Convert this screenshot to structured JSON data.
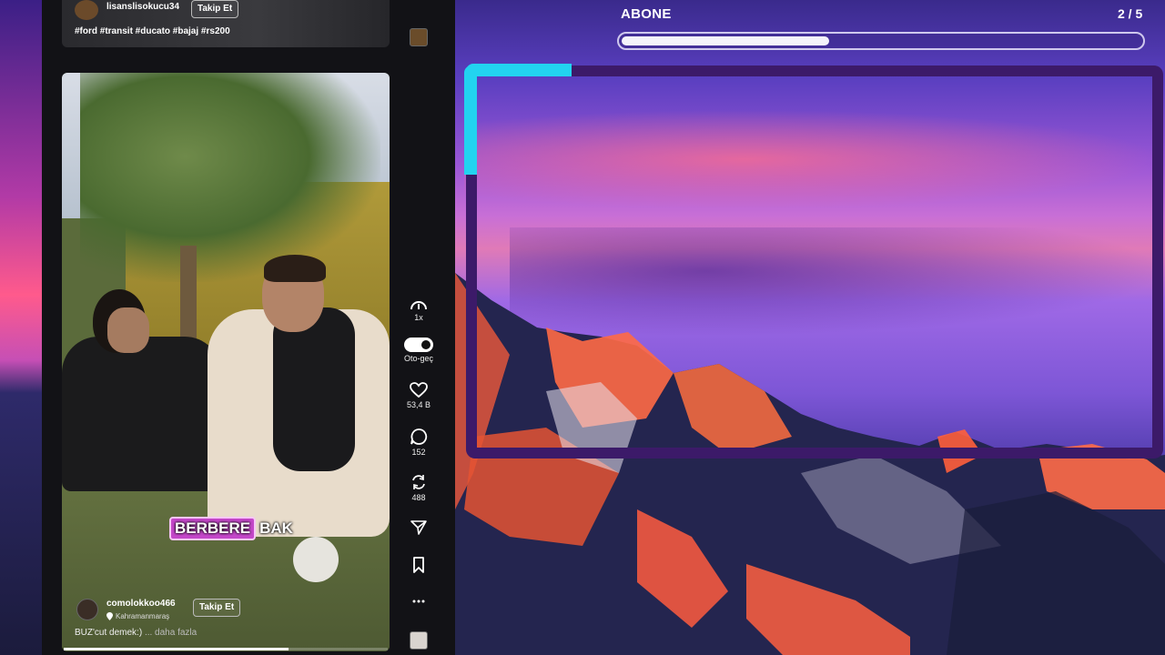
{
  "subscribe": {
    "label": "ABONE",
    "count": "2 / 5",
    "progress_fraction": 0.4
  },
  "previous_video": {
    "username": "lisanslisokucu34",
    "follow_label": "Takip Et",
    "hashtags": "#ford #transit #ducato #bajaj #rs200"
  },
  "video": {
    "caption_highlight": "BERBERE",
    "caption_rest": "BAK",
    "username": "comolokkoo466",
    "follow_label": "Takip Et",
    "location": "Kahramanmaraş",
    "description": "BUZ'cut demek:)",
    "more_label": "... daha fazla"
  },
  "rail": {
    "speed_label": "1x",
    "autoplay_label": "Oto-geç",
    "likes": "53,4 B",
    "comments": "152",
    "reposts": "488",
    "icons": [
      "speedometer-icon",
      "heart-icon",
      "comment-icon",
      "repost-icon",
      "share-icon",
      "bookmark-icon",
      "more-icon"
    ]
  },
  "colors": {
    "frame": "#3c1a69",
    "frame_accent": "#22d3f0",
    "caption_highlight": "#c447c9"
  }
}
